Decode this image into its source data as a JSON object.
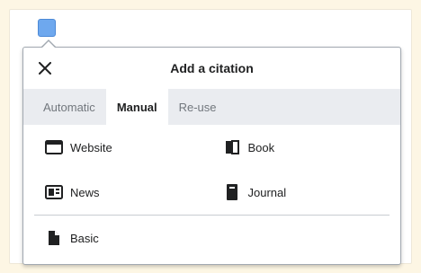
{
  "dialog": {
    "title": "Add a citation",
    "close_label": "Close"
  },
  "tabs": [
    {
      "label": "Automatic",
      "active": false
    },
    {
      "label": "Manual",
      "active": true
    },
    {
      "label": "Re-use",
      "active": false
    }
  ],
  "tools": {
    "website": {
      "label": "Website",
      "icon": "browser-window-icon"
    },
    "book": {
      "label": "Book",
      "icon": "book-icon"
    },
    "news": {
      "label": "News",
      "icon": "newspaper-icon"
    },
    "journal": {
      "label": "Journal",
      "icon": "journal-icon"
    },
    "basic": {
      "label": "Basic",
      "icon": "reference-icon"
    }
  },
  "colors": {
    "accent": "#6ea8ee",
    "tab_bar": "#eaecf0",
    "text": "#202122",
    "muted": "#72777d",
    "background": "#fdf6e4"
  }
}
